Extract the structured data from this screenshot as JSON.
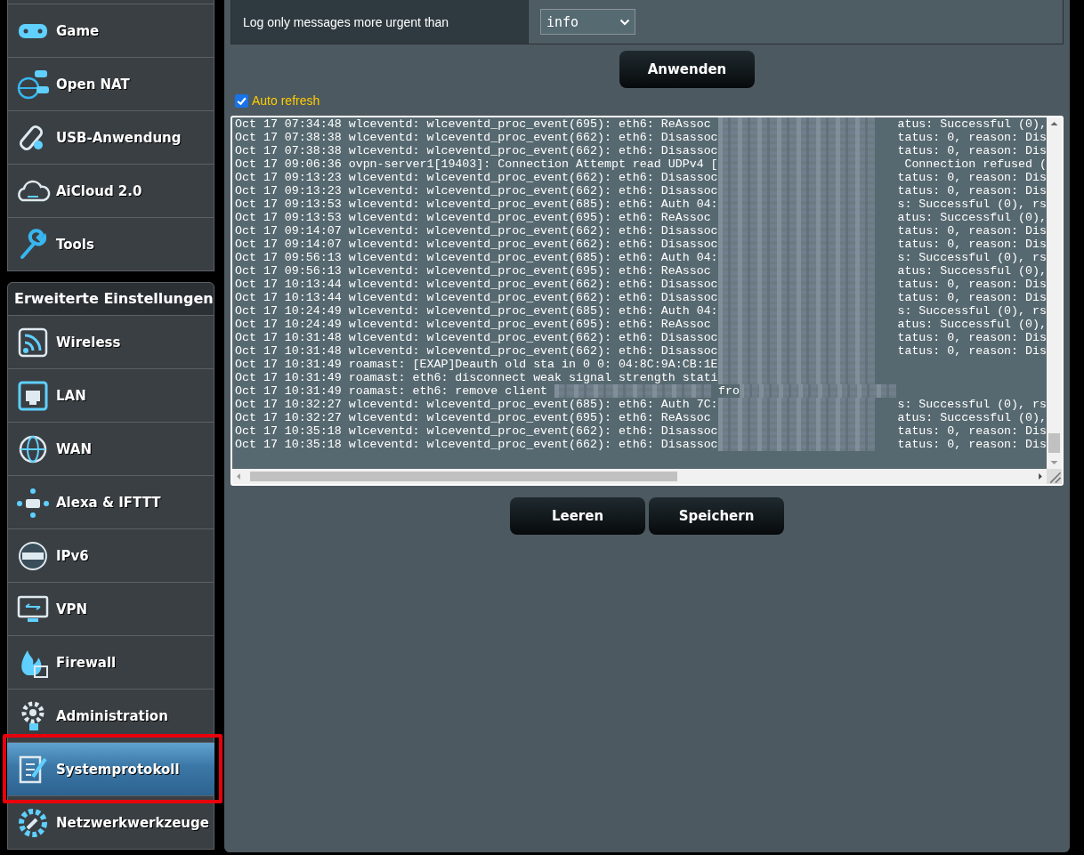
{
  "sidebar": {
    "top_items": [
      {
        "label": "Game",
        "selected": false
      },
      {
        "label": "Open NAT",
        "selected": false
      },
      {
        "label": "USB-Anwendung",
        "selected": false
      },
      {
        "label": "AiCloud 2.0",
        "selected": false
      },
      {
        "label": "Tools",
        "selected": false
      }
    ],
    "section_title": "Erweiterte Einstellungen",
    "items": [
      {
        "label": "Wireless",
        "selected": false,
        "highlighted": false
      },
      {
        "label": "LAN",
        "selected": false,
        "highlighted": false
      },
      {
        "label": "WAN",
        "selected": false,
        "highlighted": false
      },
      {
        "label": "Alexa & IFTTT",
        "selected": false,
        "highlighted": false
      },
      {
        "label": "IPv6",
        "selected": false,
        "highlighted": false
      },
      {
        "label": "VPN",
        "selected": false,
        "highlighted": false
      },
      {
        "label": "Firewall",
        "selected": false,
        "highlighted": false
      },
      {
        "label": "Administration",
        "selected": false,
        "highlighted": false
      },
      {
        "label": "Systemprotokoll",
        "selected": true,
        "highlighted": true
      },
      {
        "label": "Netzwerkwerkzeuge",
        "selected": false,
        "highlighted": false
      }
    ]
  },
  "settings": {
    "label": "Log only messages more urgent than",
    "select_value": "info"
  },
  "apply_button": "Anwenden",
  "auto_refresh": {
    "label": "Auto refresh",
    "checked": true
  },
  "log_lines": [
    [
      {
        "kind": "text",
        "text": "Oct 17 07:34:48 wlceventd: wlceventd_proc_event(695): eth6: ReAssoc "
      },
      {
        "kind": "redacted"
      },
      {
        "kind": "text",
        "text": "atus: Successful (0),"
      }
    ],
    [
      {
        "kind": "text",
        "text": "Oct 17 07:38:38 wlceventd: wlceventd_proc_event(662): eth6: Disassoc"
      },
      {
        "kind": "redacted"
      },
      {
        "kind": "text",
        "text": "tatus: 0, reason: Dis"
      }
    ],
    [
      {
        "kind": "text",
        "text": "Oct 17 07:38:38 wlceventd: wlceventd_proc_event(662): eth6: Disassoc"
      },
      {
        "kind": "redacted"
      },
      {
        "kind": "text",
        "text": "tatus: 0, reason: Dis"
      }
    ],
    [
      {
        "kind": "text",
        "text": "Oct 17 09:06:36 ovpn-server1[19403]: Connection Attempt read UDPv4 ["
      },
      {
        "kind": "redacted"
      },
      {
        "kind": "text",
        "text": "Connection refused ("
      }
    ],
    [
      {
        "kind": "text",
        "text": "Oct 17 09:13:23 wlceventd: wlceventd_proc_event(662): eth6: Disassoc"
      },
      {
        "kind": "redacted"
      },
      {
        "kind": "text",
        "text": "tatus: 0, reason: Dis"
      }
    ],
    [
      {
        "kind": "text",
        "text": "Oct 17 09:13:23 wlceventd: wlceventd_proc_event(662): eth6: Disassoc"
      },
      {
        "kind": "redacted"
      },
      {
        "kind": "text",
        "text": "tatus: 0, reason: Dis"
      }
    ],
    [
      {
        "kind": "text",
        "text": "Oct 17 09:13:53 wlceventd: wlceventd_proc_event(685): eth6: Auth 04:"
      },
      {
        "kind": "redacted"
      },
      {
        "kind": "text",
        "text": "s: Successful (0), rs"
      }
    ],
    [
      {
        "kind": "text",
        "text": "Oct 17 09:13:53 wlceventd: wlceventd_proc_event(695): eth6: ReAssoc "
      },
      {
        "kind": "redacted"
      },
      {
        "kind": "text",
        "text": "atus: Successful (0),"
      }
    ],
    [
      {
        "kind": "text",
        "text": "Oct 17 09:14:07 wlceventd: wlceventd_proc_event(662): eth6: Disassoc"
      },
      {
        "kind": "redacted"
      },
      {
        "kind": "text",
        "text": "tatus: 0, reason: Dis"
      }
    ],
    [
      {
        "kind": "text",
        "text": "Oct 17 09:14:07 wlceventd: wlceventd_proc_event(662): eth6: Disassoc"
      },
      {
        "kind": "redacted"
      },
      {
        "kind": "text",
        "text": "tatus: 0, reason: Dis"
      }
    ],
    [
      {
        "kind": "text",
        "text": "Oct 17 09:56:13 wlceventd: wlceventd_proc_event(685): eth6: Auth 04:"
      },
      {
        "kind": "redacted"
      },
      {
        "kind": "text",
        "text": "s: Successful (0), rs"
      }
    ],
    [
      {
        "kind": "text",
        "text": "Oct 17 09:56:13 wlceventd: wlceventd_proc_event(695): eth6: ReAssoc "
      },
      {
        "kind": "redacted"
      },
      {
        "kind": "text",
        "text": "atus: Successful (0),"
      }
    ],
    [
      {
        "kind": "text",
        "text": "Oct 17 10:13:44 wlceventd: wlceventd_proc_event(662): eth6: Disassoc"
      },
      {
        "kind": "redacted"
      },
      {
        "kind": "text",
        "text": "tatus: 0, reason: Dis"
      }
    ],
    [
      {
        "kind": "text",
        "text": "Oct 17 10:13:44 wlceventd: wlceventd_proc_event(662): eth6: Disassoc"
      },
      {
        "kind": "redacted"
      },
      {
        "kind": "text",
        "text": "tatus: 0, reason: Dis"
      }
    ],
    [
      {
        "kind": "text",
        "text": "Oct 17 10:24:49 wlceventd: wlceventd_proc_event(685): eth6: Auth 04:"
      },
      {
        "kind": "redacted"
      },
      {
        "kind": "text",
        "text": "s: Successful (0), rs"
      }
    ],
    [
      {
        "kind": "text",
        "text": "Oct 17 10:24:49 wlceventd: wlceventd_proc_event(695): eth6: ReAssoc "
      },
      {
        "kind": "redacted"
      },
      {
        "kind": "text",
        "text": "atus: Successful (0),"
      }
    ],
    [
      {
        "kind": "text",
        "text": "Oct 17 10:31:48 wlceventd: wlceventd_proc_event(662): eth6: Disassoc"
      },
      {
        "kind": "redacted"
      },
      {
        "kind": "text",
        "text": "tatus: 0, reason: Dis"
      }
    ],
    [
      {
        "kind": "text",
        "text": "Oct 17 10:31:48 wlceventd: wlceventd_proc_event(662): eth6: Disassoc"
      },
      {
        "kind": "redacted"
      },
      {
        "kind": "text",
        "text": "tatus: 0, reason: Dis"
      }
    ],
    [
      {
        "kind": "text",
        "text": "Oct 17 10:31:49 roamast: [EXAP]Deauth old sta in 0 0: 04:8C:9A:CB:1E"
      },
      {
        "kind": "redacted"
      }
    ],
    [
      {
        "kind": "text",
        "text": "Oct 17 10:31:49 roamast: eth6: disconnect weak signal strength stati"
      },
      {
        "kind": "redacted"
      }
    ],
    [
      {
        "kind": "text",
        "text": "Oct 17 10:31:49 roamast: eth6: remove client "
      },
      {
        "kind": "redacted"
      },
      {
        "kind": "text",
        "text": " fro"
      },
      {
        "kind": "redacted"
      }
    ],
    [
      {
        "kind": "text",
        "text": "Oct 17 10:32:27 wlceventd: wlceventd_proc_event(685): eth6: Auth 7C:"
      },
      {
        "kind": "redacted"
      },
      {
        "kind": "text",
        "text": "s: Successful (0), rs"
      }
    ],
    [
      {
        "kind": "text",
        "text": "Oct 17 10:32:27 wlceventd: wlceventd_proc_event(695): eth6: ReAssoc "
      },
      {
        "kind": "redacted"
      },
      {
        "kind": "text",
        "text": "atus: Successful (0),"
      }
    ],
    [
      {
        "kind": "text",
        "text": "Oct 17 10:35:18 wlceventd: wlceventd_proc_event(662): eth6: Disassoc"
      },
      {
        "kind": "redacted"
      },
      {
        "kind": "text",
        "text": "tatus: 0, reason: Dis"
      }
    ],
    [
      {
        "kind": "text",
        "text": "Oct 17 10:35:18 wlceventd: wlceventd_proc_event(662): eth6: Disassoc"
      },
      {
        "kind": "redacted"
      },
      {
        "kind": "text",
        "text": "tatus: 0, reason: Dis"
      }
    ]
  ],
  "buttons": [
    "Leeren",
    "Speichern"
  ]
}
